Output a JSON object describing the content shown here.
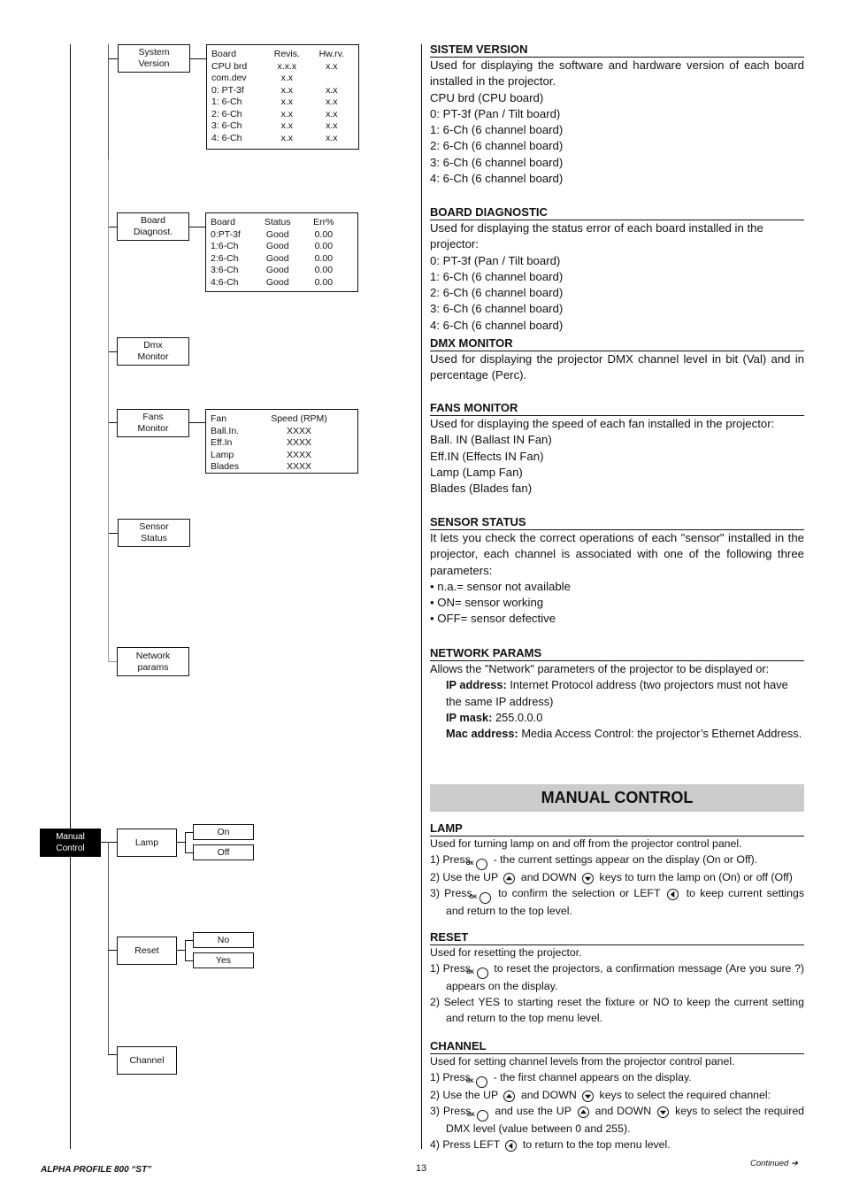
{
  "menu_tree": {
    "nodes": {
      "system_version": "System\nVersion",
      "board_diagnost": "Board\nDiagnost.",
      "dmx_monitor": "Dmx\nMonitor",
      "fans_monitor": "Fans\nMonitor",
      "sensor_status": "Sensor\nStatus",
      "network_params": "Network\nparams",
      "manual_control": "Manual\nControl",
      "lamp": "Lamp",
      "reset": "Reset",
      "channel": "Channel"
    },
    "lamp_options": [
      "On",
      "Off"
    ],
    "reset_options": [
      "No",
      "Yes"
    ],
    "system_version_table": {
      "headers": [
        "Board",
        "Revis.",
        "Hw.rv."
      ],
      "rows": [
        [
          "CPU brd",
          "x.x.x",
          "x.x"
        ],
        [
          "com.dev",
          "x.x",
          ""
        ],
        [
          "0: PT-3f",
          "x.x",
          "x.x"
        ],
        [
          "1: 6-Ch",
          "x.x",
          "x.x"
        ],
        [
          "2: 6-Ch",
          "x.x",
          "x.x"
        ],
        [
          "3: 6-Ch",
          "x.x",
          "x.x"
        ],
        [
          "4: 6-Ch",
          "x.x",
          "x.x"
        ]
      ]
    },
    "board_diag_table": {
      "headers": [
        "Board",
        "Status",
        "Err%"
      ],
      "rows": [
        [
          "0:PT-3f",
          "Good",
          "0.00"
        ],
        [
          "1:6-Ch",
          "Good",
          "0.00"
        ],
        [
          "2:6-Ch",
          "Good",
          "0.00"
        ],
        [
          "3:6-Ch",
          "Good",
          "0.00"
        ],
        [
          "4:6-Ch",
          "Good",
          "0.00"
        ]
      ]
    },
    "fans_table": {
      "headers": [
        "Fan",
        "Speed (RPM)"
      ],
      "rows": [
        [
          "Ball.In.",
          "XXXX"
        ],
        [
          "Eff.In",
          "XXXX"
        ],
        [
          "Lamp",
          "XXXX"
        ],
        [
          "Blades",
          "XXXX"
        ]
      ]
    }
  },
  "sections": {
    "system_version": {
      "title": "SISTEM VERSION",
      "intro": "Used for displaying the software and hardware version of each board installed in the projector.",
      "lines": [
        "CPU brd (CPU board)",
        "0: PT-3f (Pan / Tilt board)",
        "1: 6-Ch (6 channel board)",
        "2: 6-Ch (6 channel board)",
        "3: 6-Ch (6 channel board)",
        "4: 6-Ch (6 channel board)"
      ]
    },
    "board_diagnostic": {
      "title": "BOARD DIAGNOSTIC",
      "intro": "Used for displaying the status error of each board installed in the projector:",
      "lines": [
        "0: PT-3f (Pan / Tilt board)",
        "1: 6-Ch (6 channel board)",
        "2: 6-Ch (6 channel board)",
        "3: 6-Ch (6 channel board)",
        "4: 6-Ch (6 channel board)"
      ]
    },
    "dmx_monitor": {
      "title": "DMX MONITOR",
      "intro": "Used for displaying the projector DMX channel level in bit (Val) and in percentage (Perc)."
    },
    "fans_monitor": {
      "title": "FANS MONITOR",
      "intro": "Used for displaying the speed of each fan installed in the projector:",
      "lines": [
        "Ball. IN (Ballast IN Fan)",
        "Eff.IN (Effects IN Fan)",
        "Lamp (Lamp Fan)",
        "Blades (Blades fan)"
      ]
    },
    "sensor_status": {
      "title": "SENSOR STATUS",
      "intro": "It lets you check the correct operations of each \"sensor\" installed in the projector, each channel is associated with one of the following three parameters:",
      "bullets": [
        "• n.a.= sensor not available",
        "• ON= sensor working",
        "• OFF= sensor defective"
      ]
    },
    "network_params": {
      "title": "NETWORK PARAMS",
      "intro": "Allows the \"Network\" parameters of the projector to be displayed or:",
      "items": [
        {
          "term": "IP address:",
          "desc": " Internet Protocol address (two projectors must not have the same IP address)"
        },
        {
          "term": "IP mask:",
          "desc": " 255.0.0.0"
        },
        {
          "term": "Mac address:",
          "desc": " Media Access Control: the projector’s Ethernet Address."
        }
      ]
    },
    "manual_control_banner": "MANUAL CONTROL",
    "lamp": {
      "title": "LAMP",
      "intro": "Used for turning lamp on and off from the projector control panel.",
      "step1a": "1)  Press ",
      "step1b": " - the current settings appear on the display (On or Off).",
      "step2a": "2)  Use the UP ",
      "step2b": " and DOWN ",
      "step2c": " keys to turn the lamp on (On) or off (Off)",
      "step3a": "3)  Press ",
      "step3b": " to confirm the selection or LEFT ",
      "step3c": " to keep current settings and return to the top level."
    },
    "reset": {
      "title": "RESET",
      "intro": "Used for resetting the projector.",
      "step1a": "1)  Press ",
      "step1b": " to reset the projectors, a confirmation message (Are you sure ?) appears on the display.",
      "step2": "2)  Select YES to starting reset the fixture or NO to keep the current setting and return to the top menu level."
    },
    "channel": {
      "title": "CHANNEL",
      "intro": "Used for setting channel levels from the projector control panel.",
      "step1a": "1)  Press ",
      "step1b": " - the first channel appears on the display.",
      "step2a": "2)  Use the UP ",
      "step2b": " and DOWN ",
      "step2c": " keys to select the required channel:",
      "step3a": "3) Press ",
      "step3b": " and use the UP ",
      "step3c": " and DOWN ",
      "step3d": " keys to select the required DMX level (value between 0 and 255).",
      "step4a": "4) Press LEFT ",
      "step4b": " to return to the top menu level."
    }
  },
  "keys": {
    "ok": "OK"
  },
  "footer": {
    "product": "ALPHA PROFILE 800 “ST”",
    "page": "13",
    "continued": "Continued ➔"
  }
}
